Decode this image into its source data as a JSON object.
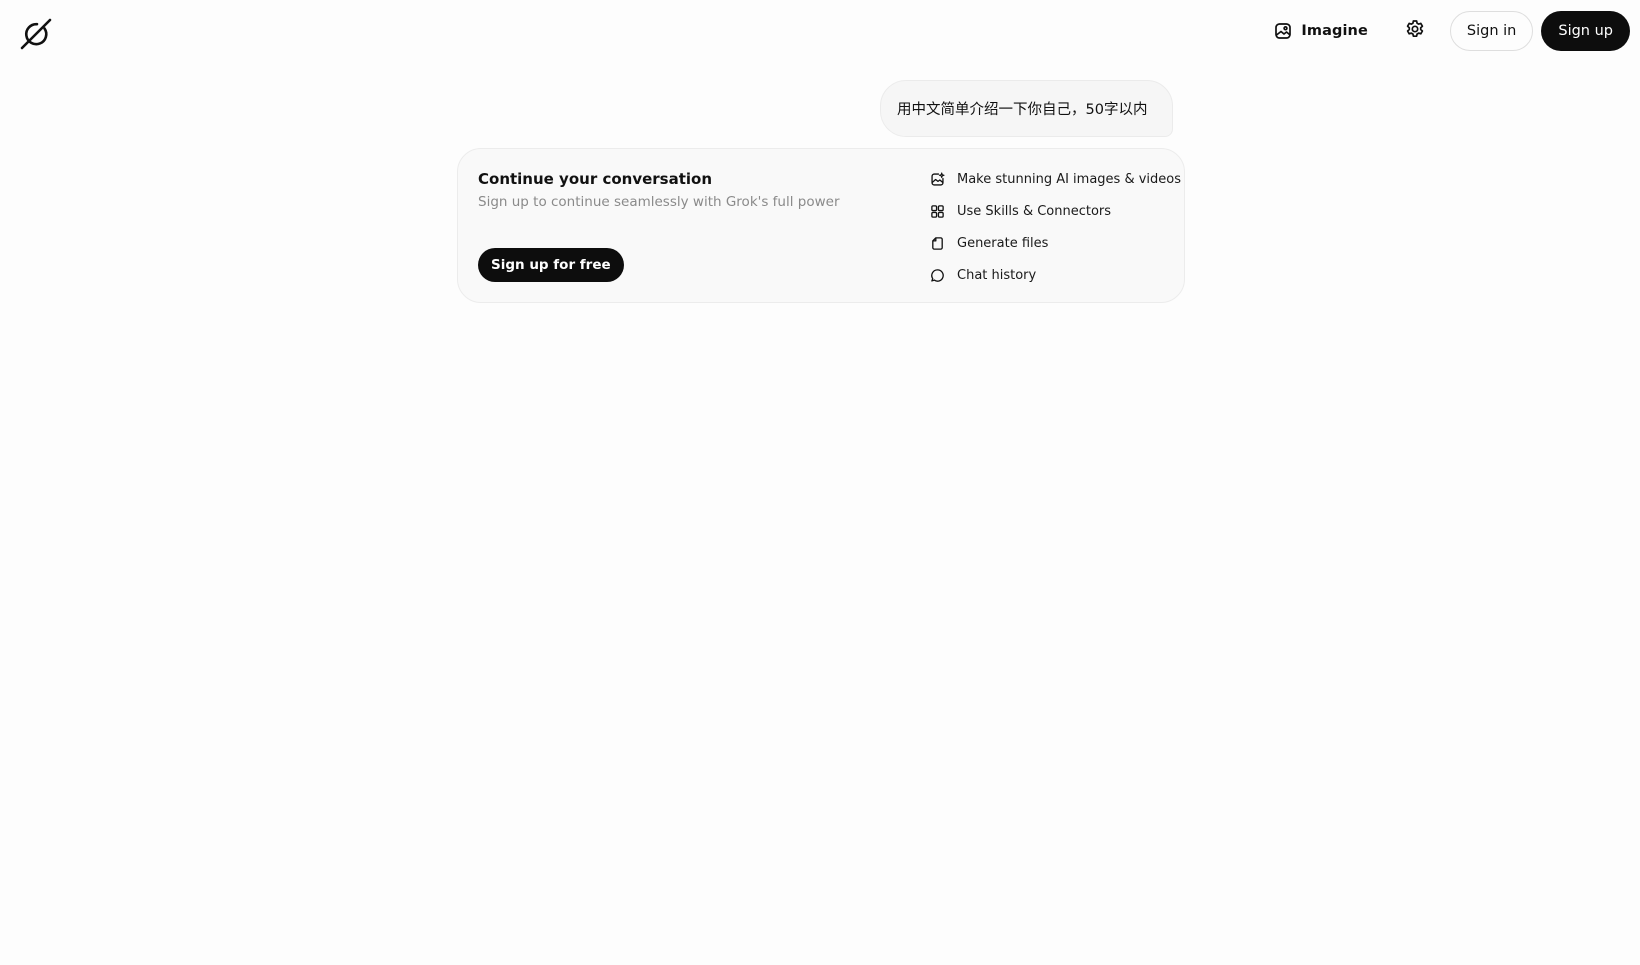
{
  "header": {
    "logo_icon": "grok-logo-icon",
    "imagine_label": "Imagine",
    "imagine_icon": "imagine-icon",
    "settings_icon": "gear-icon",
    "signin_label": "Sign in",
    "signup_label": "Sign up"
  },
  "conversation": {
    "user_message": "用中文简单介绍一下你自己，50字以内"
  },
  "continue_card": {
    "title": "Continue your conversation",
    "subtitle": "Sign up to continue seamlessly with Grok's full power",
    "cta_label": "Sign up for free",
    "features": [
      {
        "icon": "image-sparkle-icon",
        "label": "Make stunning AI images & videos"
      },
      {
        "icon": "skills-grid-icon",
        "label": "Use Skills & Connectors"
      },
      {
        "icon": "file-icon",
        "label": "Generate files"
      },
      {
        "icon": "chat-bubble-icon",
        "label": "Chat history"
      }
    ]
  },
  "colors": {
    "page_background": "#fdfdfd",
    "primary_button": "#0d0d0d",
    "card_background": "#f9f9f9",
    "subtitle_text": "#8a8a8a"
  }
}
